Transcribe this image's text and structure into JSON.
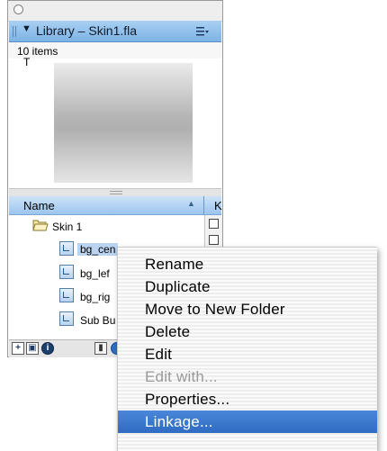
{
  "panel": {
    "title": "Library – Skin1.fla",
    "items_count": "10 items",
    "text_cursor": "T",
    "collapse_arrow": "▼",
    "sort_arrow": "▲",
    "columns": {
      "name": "Name",
      "kind": "K"
    },
    "rows": [
      {
        "label": "Skin 1",
        "icon": "folder-icon",
        "selected": false
      },
      {
        "label": "bg_cen",
        "icon": "symbol-icon",
        "selected": true
      },
      {
        "label": "bg_lef",
        "icon": "symbol-icon",
        "selected": false
      },
      {
        "label": "bg_rig",
        "icon": "symbol-icon",
        "selected": false
      },
      {
        "label": "Sub Bu",
        "icon": "symbol-icon",
        "selected": false
      }
    ],
    "toolbar": [
      "new-symbol-icon",
      "new-folder-icon",
      "properties-info-icon",
      "trash-icon",
      "blue-circle-icon"
    ],
    "toolbar_glyphs": {
      "new_symbol": "+",
      "new_folder": "▣",
      "info": "i",
      "trash": "▮"
    }
  },
  "context_menu": {
    "items": [
      {
        "label": "Rename",
        "enabled": true,
        "highlighted": false
      },
      {
        "label": "Duplicate",
        "enabled": true,
        "highlighted": false
      },
      {
        "label": "Move to New Folder",
        "enabled": true,
        "highlighted": false
      },
      {
        "label": "Delete",
        "enabled": true,
        "highlighted": false
      },
      {
        "label": "Edit",
        "enabled": true,
        "highlighted": false
      },
      {
        "label": "Edit with...",
        "enabled": false,
        "highlighted": false
      },
      {
        "label": "Properties...",
        "enabled": true,
        "highlighted": false
      },
      {
        "label": "Linkage...",
        "enabled": true,
        "highlighted": true
      }
    ]
  },
  "colors": {
    "title_bar": "#7db3e6",
    "selection_highlight": "#2f6cc2",
    "disabled_text": "#9a9a9a"
  }
}
